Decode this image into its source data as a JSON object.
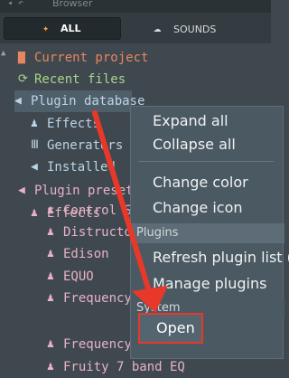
{
  "header": {
    "title": "Browser",
    "tab_all": "ALL",
    "tab_sounds": "SOUNDS"
  },
  "tree": {
    "current_project": "Current project",
    "recent_files": "Recent files",
    "plugin_database": "Plugin database",
    "effects": "Effects",
    "generators": "Generators",
    "installed": "Installed",
    "plugin_presets": "Plugin presets",
    "presets_effects": "Effects",
    "items": [
      "Control Sur",
      "Distructor",
      "Edison",
      "EQUO",
      "Frequency S",
      "Frequency S",
      "Fruity 7 band EQ"
    ]
  },
  "menu": {
    "expand_all": "Expand all",
    "collapse_all": "Collapse all",
    "change_color": "Change color",
    "change_icon": "Change icon",
    "section_plugins": "Plugins",
    "refresh_plugin_list": "Refresh plugin list (",
    "manage_plugins": "Manage plugins",
    "section_system": "System",
    "open": "Open"
  },
  "colors": {
    "annotation_red": "#e8382a",
    "accent_orange": "#f2a23a"
  }
}
